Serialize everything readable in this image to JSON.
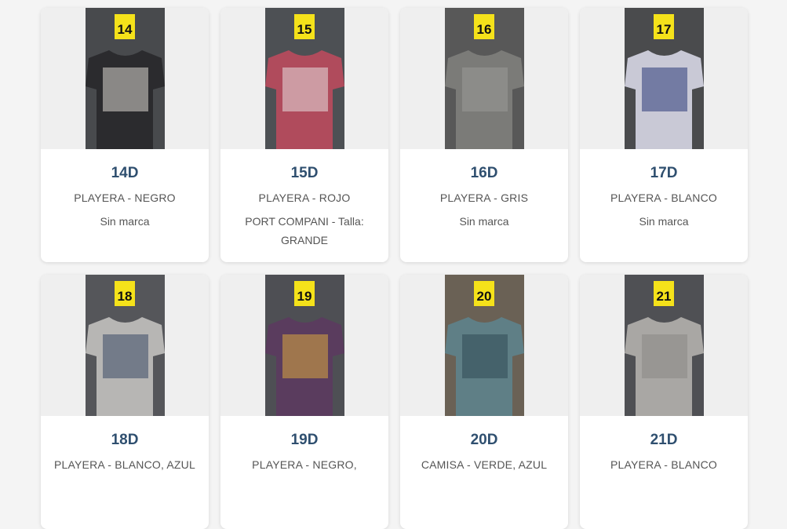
{
  "cards": [
    {
      "marker": "14",
      "code": "14D",
      "description": "PLAYERA - NEGRO",
      "brand": "Sin marca",
      "colors": {
        "bg": "#484a4d",
        "garment": "#2b2b2e",
        "accent": "#d8d6d0"
      }
    },
    {
      "marker": "15",
      "code": "15D",
      "description": "PLAYERA - ROJO",
      "brand": "PORT COMPANI - Talla: GRANDE",
      "colors": {
        "bg": "#4d5054",
        "garment": "#b04b5c",
        "accent": "#e6dede"
      }
    },
    {
      "marker": "16",
      "code": "16D",
      "description": "PLAYERA - GRIS",
      "brand": "Sin marca",
      "colors": {
        "bg": "#585858",
        "garment": "#7b7b78",
        "accent": "#9a9a98"
      }
    },
    {
      "marker": "17",
      "code": "17D",
      "description": "PLAYERA - BLANCO",
      "brand": "Sin marca",
      "colors": {
        "bg": "#4a4b4d",
        "garment": "#c9c9d6",
        "accent": "#2c3a7a"
      }
    },
    {
      "marker": "18",
      "code": "18D",
      "description": "PLAYERA - BLANCO, AZUL",
      "brand": "",
      "colors": {
        "bg": "#55565a",
        "garment": "#b7b6b4",
        "accent": "#3d4a66"
      }
    },
    {
      "marker": "19",
      "code": "19D",
      "description": "PLAYERA - NEGRO,",
      "brand": "",
      "colors": {
        "bg": "#4e4f54",
        "garment": "#5a3c5e",
        "accent": "#d8a640"
      }
    },
    {
      "marker": "20",
      "code": "20D",
      "description": "CAMISA - VERDE, AZUL",
      "brand": "",
      "colors": {
        "bg": "#6a6155",
        "garment": "#5f7f86",
        "accent": "#2f4a55"
      }
    },
    {
      "marker": "21",
      "code": "21D",
      "description": "PLAYERA - BLANCO",
      "brand": "",
      "colors": {
        "bg": "#4f5054",
        "garment": "#a9a7a4",
        "accent": "#8a8885"
      }
    }
  ]
}
